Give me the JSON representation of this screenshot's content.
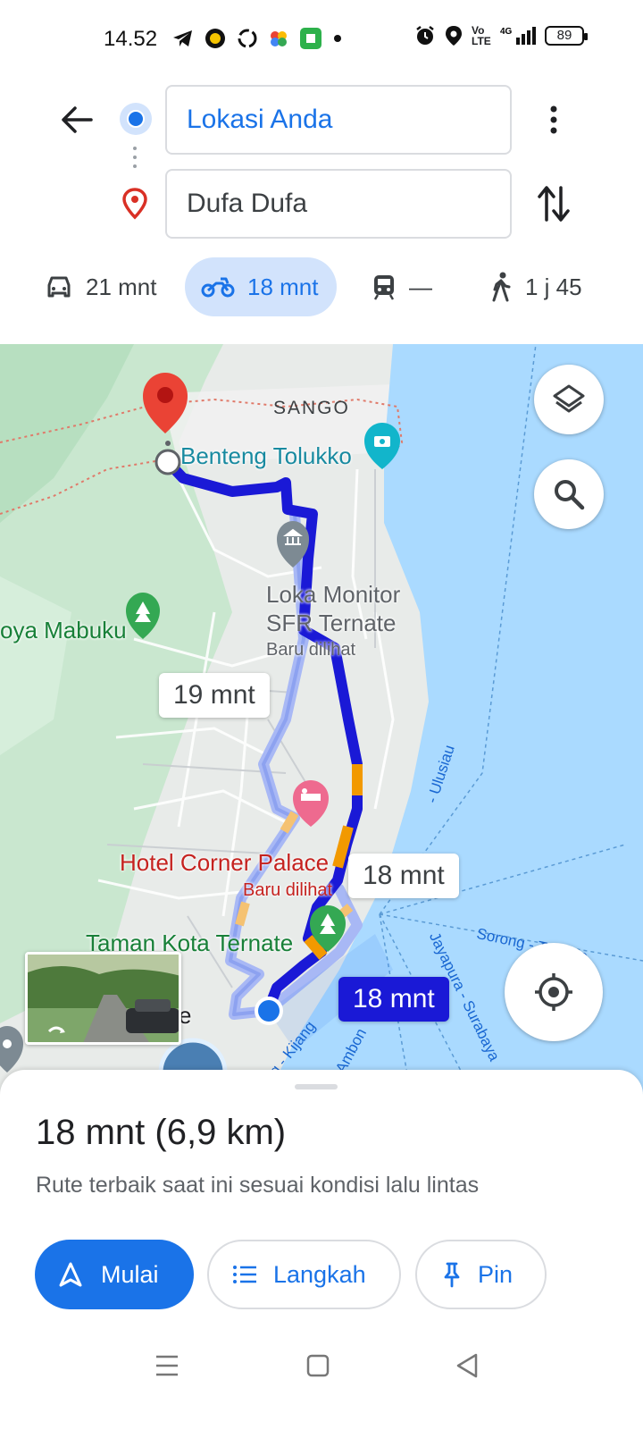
{
  "status_bar": {
    "time": "14.52",
    "battery": "89",
    "network": "4G",
    "volte": "Vo LTE"
  },
  "directions": {
    "origin": "Lokasi Anda",
    "destination": "Dufa Dufa"
  },
  "modes": [
    {
      "name": "car",
      "label": "21 mnt"
    },
    {
      "name": "motorcycle",
      "label": "18 mnt",
      "selected": true
    },
    {
      "name": "transit",
      "label": "—"
    },
    {
      "name": "walk",
      "label": "1 j 45"
    }
  ],
  "map": {
    "labels": {
      "sango": "SANGO",
      "benteng": "Benteng Tolukko",
      "loka_line1": "Loka Monitor",
      "loka_line2": "SFR Ternate",
      "loka_sub": "Baru dilihat",
      "mabuku": "oya Mabuku",
      "hotel": "Hotel Corner Palace",
      "hotel_sub": "Baru dilihat",
      "taman": "Taman Kota Ternate",
      "partial_e": "e",
      "ulusiau": "- Ulusiau",
      "sorong": "Sorong - Ternate",
      "jayapura": "Jayapura - Surabaya",
      "ambon": "Ambon",
      "kijang": "ng - Kijang"
    },
    "bubbles": {
      "alt_route": "19 mnt",
      "alt_route_2": "18 mnt",
      "selected_route": "18 mnt"
    },
    "colors": {
      "route": "#1a19d6",
      "alt_route": "#a8b8f5",
      "traffic": "#f29900",
      "water": "#aadaff",
      "park": "#c9e7cf"
    }
  },
  "sheet": {
    "summary": "18 mnt (6,9 km)",
    "subtitle": "Rute terbaik saat ini sesuai kondisi lalu lintas",
    "start_label": "Mulai",
    "steps_label": "Langkah",
    "pin_label": "Pin"
  }
}
